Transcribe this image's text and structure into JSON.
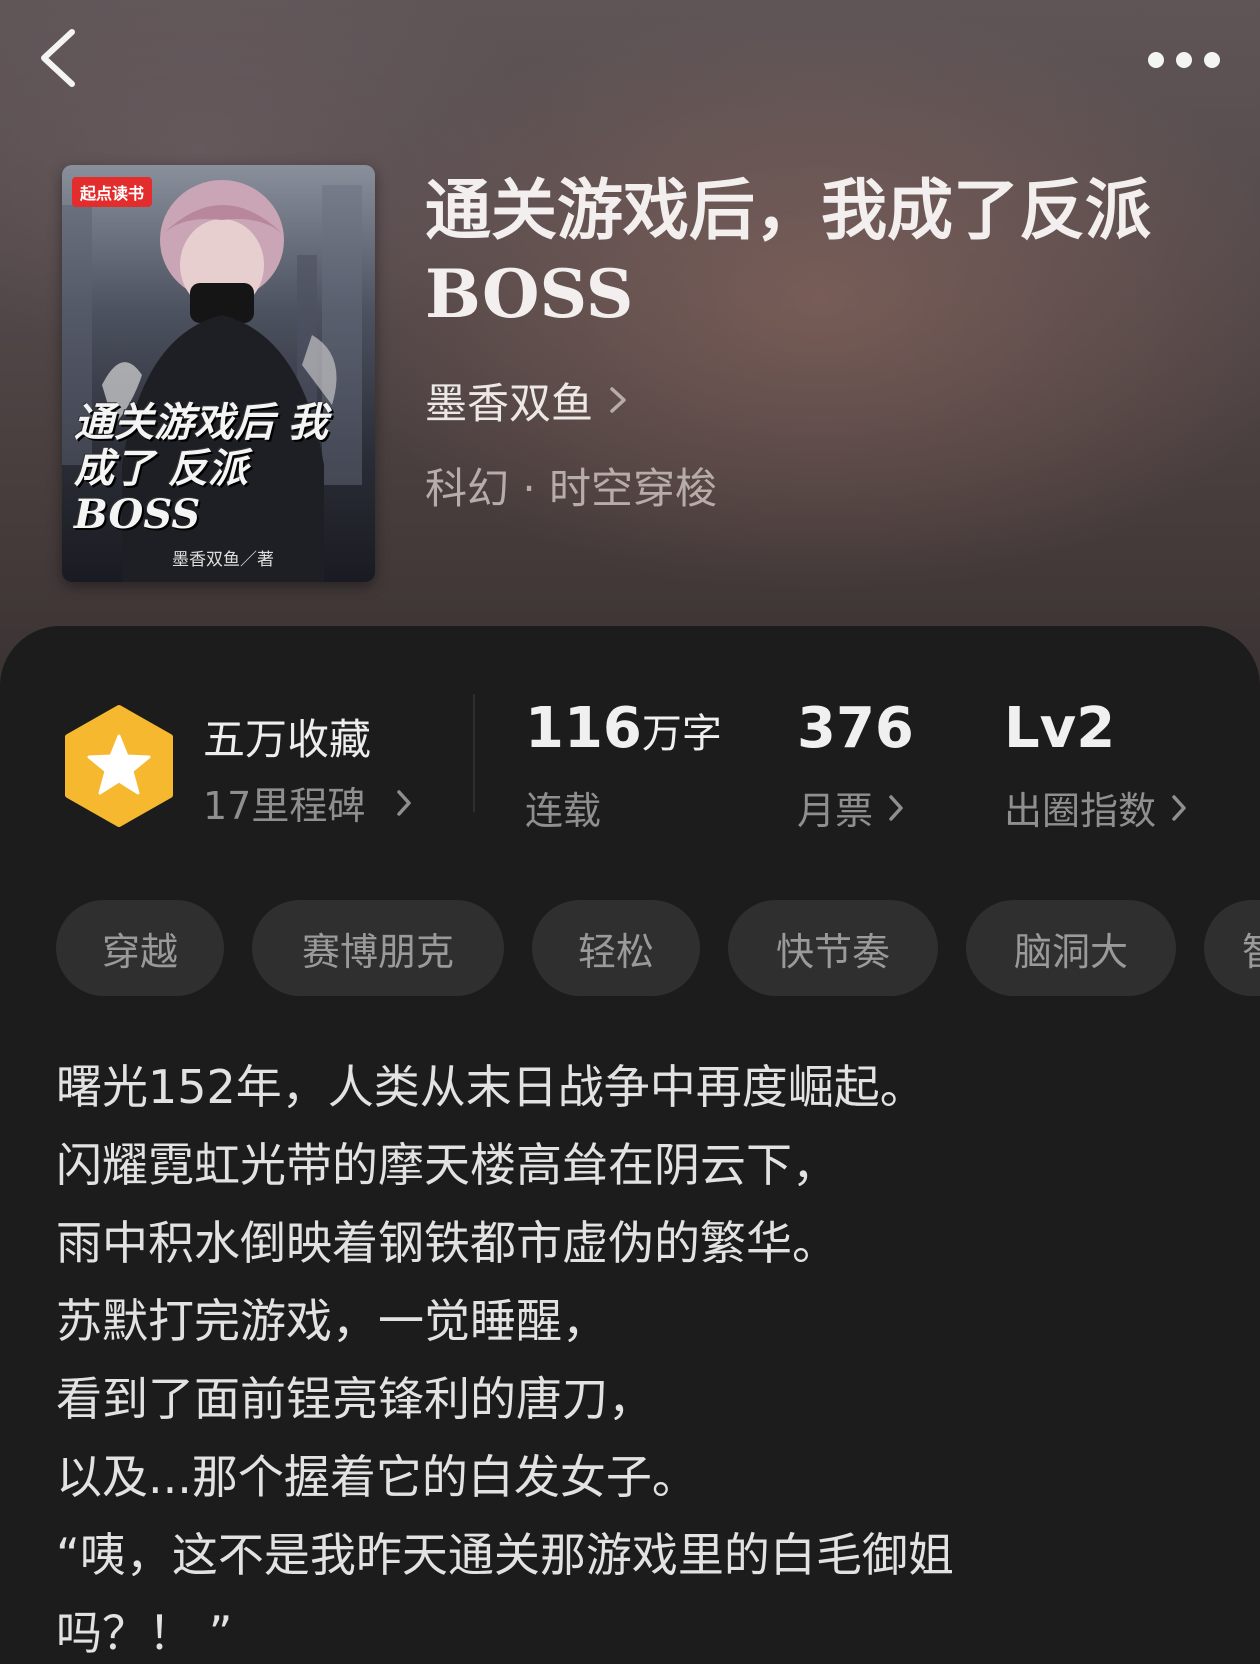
{
  "nav": {
    "back_icon": "chevron-left-icon",
    "more_icon": "more-dots-icon"
  },
  "cover": {
    "logo_text": "起点读书",
    "title_text": "通关游戏后 我成了 反派BOSS",
    "author_text": "墨香双鱼／著"
  },
  "book": {
    "title_line1": "通关游戏后，我成了反派",
    "title_line2": "BOSS",
    "author": "墨香双鱼",
    "genre": "科幻 · 时空穿梭"
  },
  "stats": {
    "collect_title": "五万收藏",
    "milestone": "17里程碑",
    "words_value": "116",
    "words_unit": "万字",
    "status": "连载",
    "monthly_votes_value": "376",
    "monthly_votes_label": "月票",
    "circle_index_value": "Lv2",
    "circle_index_label": "出圈指数",
    "badge_color": "#f5b82e"
  },
  "tags": [
    "穿越",
    "赛博朋克",
    "轻松",
    "快节奏",
    "脑洞大",
    "智"
  ],
  "synopsis": [
    "曙光152年，人类从末日战争中再度崛起。",
    "闪耀霓虹光带的摩天楼高耸在阴云下，",
    "雨中积水倒映着钢铁都市虚伪的繁华。",
    "苏默打完游戏，一觉睡醒，",
    "看到了面前锃亮锋利的唐刀，",
    "以及...那个握着它的白发女子。",
    "“咦，这不是我昨天通关那游戏里的白毛御姐",
    "吗？！ ”"
  ]
}
